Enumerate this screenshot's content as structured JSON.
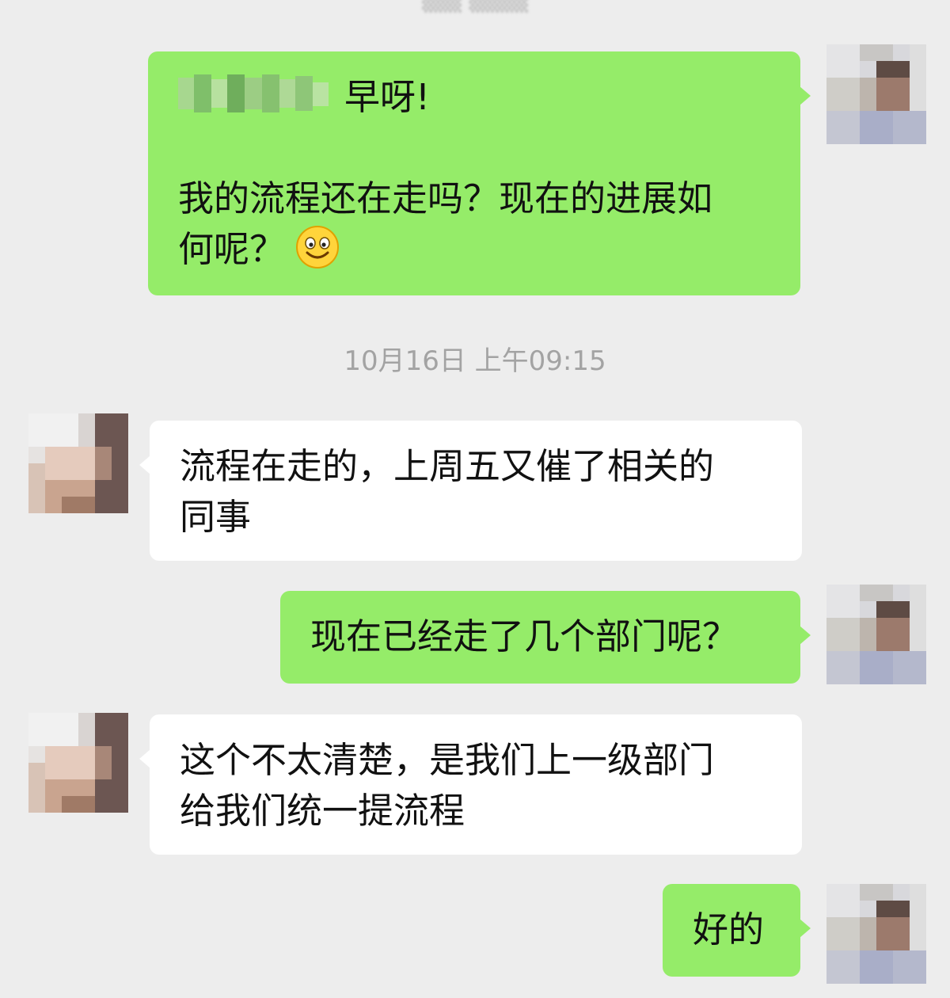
{
  "chat": {
    "timestamp": "10月16日 上午09:15",
    "messages": [
      {
        "greeting": "早呀!",
        "body": "我的流程还在走吗？现在的进展如\n何呢？"
      },
      {
        "text": "流程在走的，上周五又催了相关的\n同事"
      },
      {
        "text": "现在已经走了几个部门呢？"
      },
      {
        "text": "这个不太清楚，是我们上一级部门\n给我们统一提流程"
      },
      {
        "text": "好的"
      }
    ]
  },
  "emoji": {
    "name": "smile-emoji-icon"
  },
  "colors": {
    "background": "#ededed",
    "outgoing_bubble": "#95ec69",
    "incoming_bubble": "#ffffff",
    "timestamp_text": "#a3a3a3"
  }
}
